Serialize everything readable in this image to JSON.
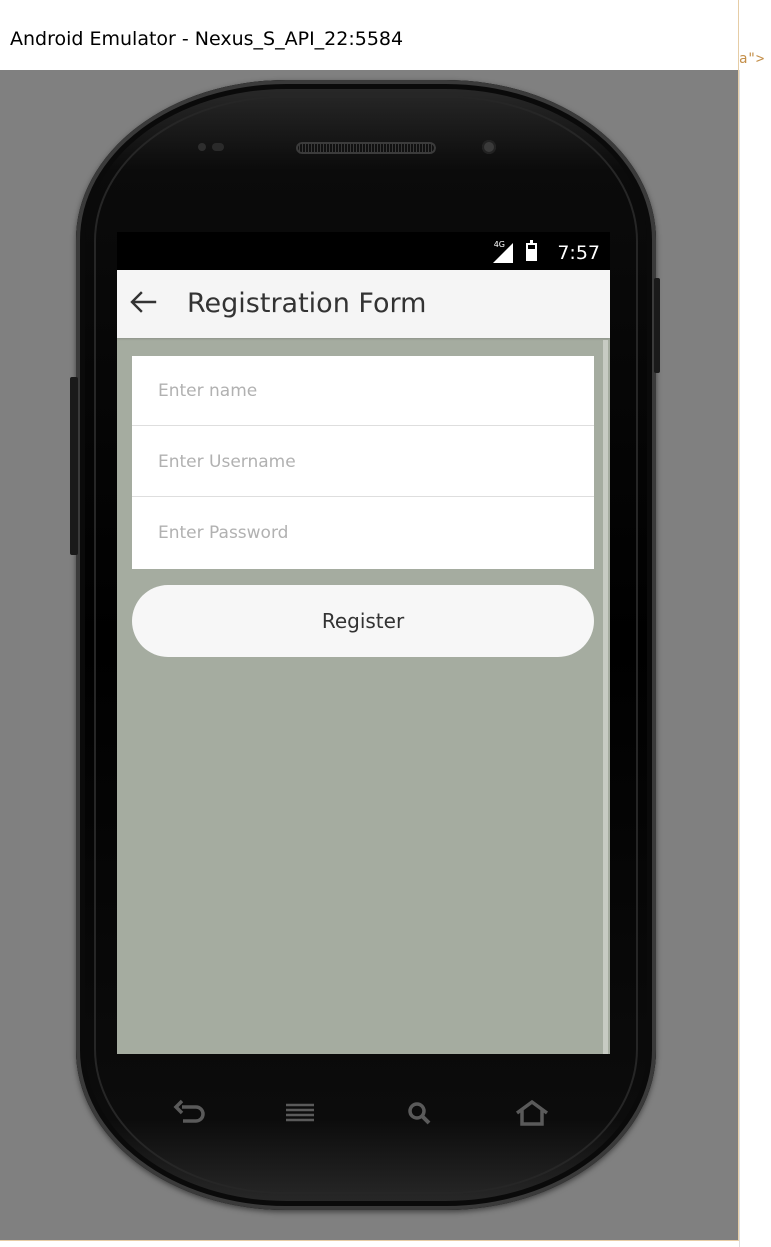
{
  "window": {
    "title": "Android Emulator - Nexus_S_API_22:5584",
    "background_fragment": "a\">"
  },
  "status_bar": {
    "network_label": "4G",
    "time": "7:57"
  },
  "app_bar": {
    "back_icon": "arrow-left-icon",
    "title": "Registration Form"
  },
  "form": {
    "name_placeholder": "Enter name",
    "username_placeholder": "Enter Username",
    "password_placeholder": "Enter Password",
    "register_label": "Register"
  },
  "nav_buttons": [
    "back-icon",
    "menu-icon",
    "search-icon",
    "home-icon"
  ],
  "colors": {
    "emulator_background": "#808080",
    "screen_background": "#a5aca0",
    "app_bar": "#f5f5f5",
    "button": "#f7f7f7"
  }
}
